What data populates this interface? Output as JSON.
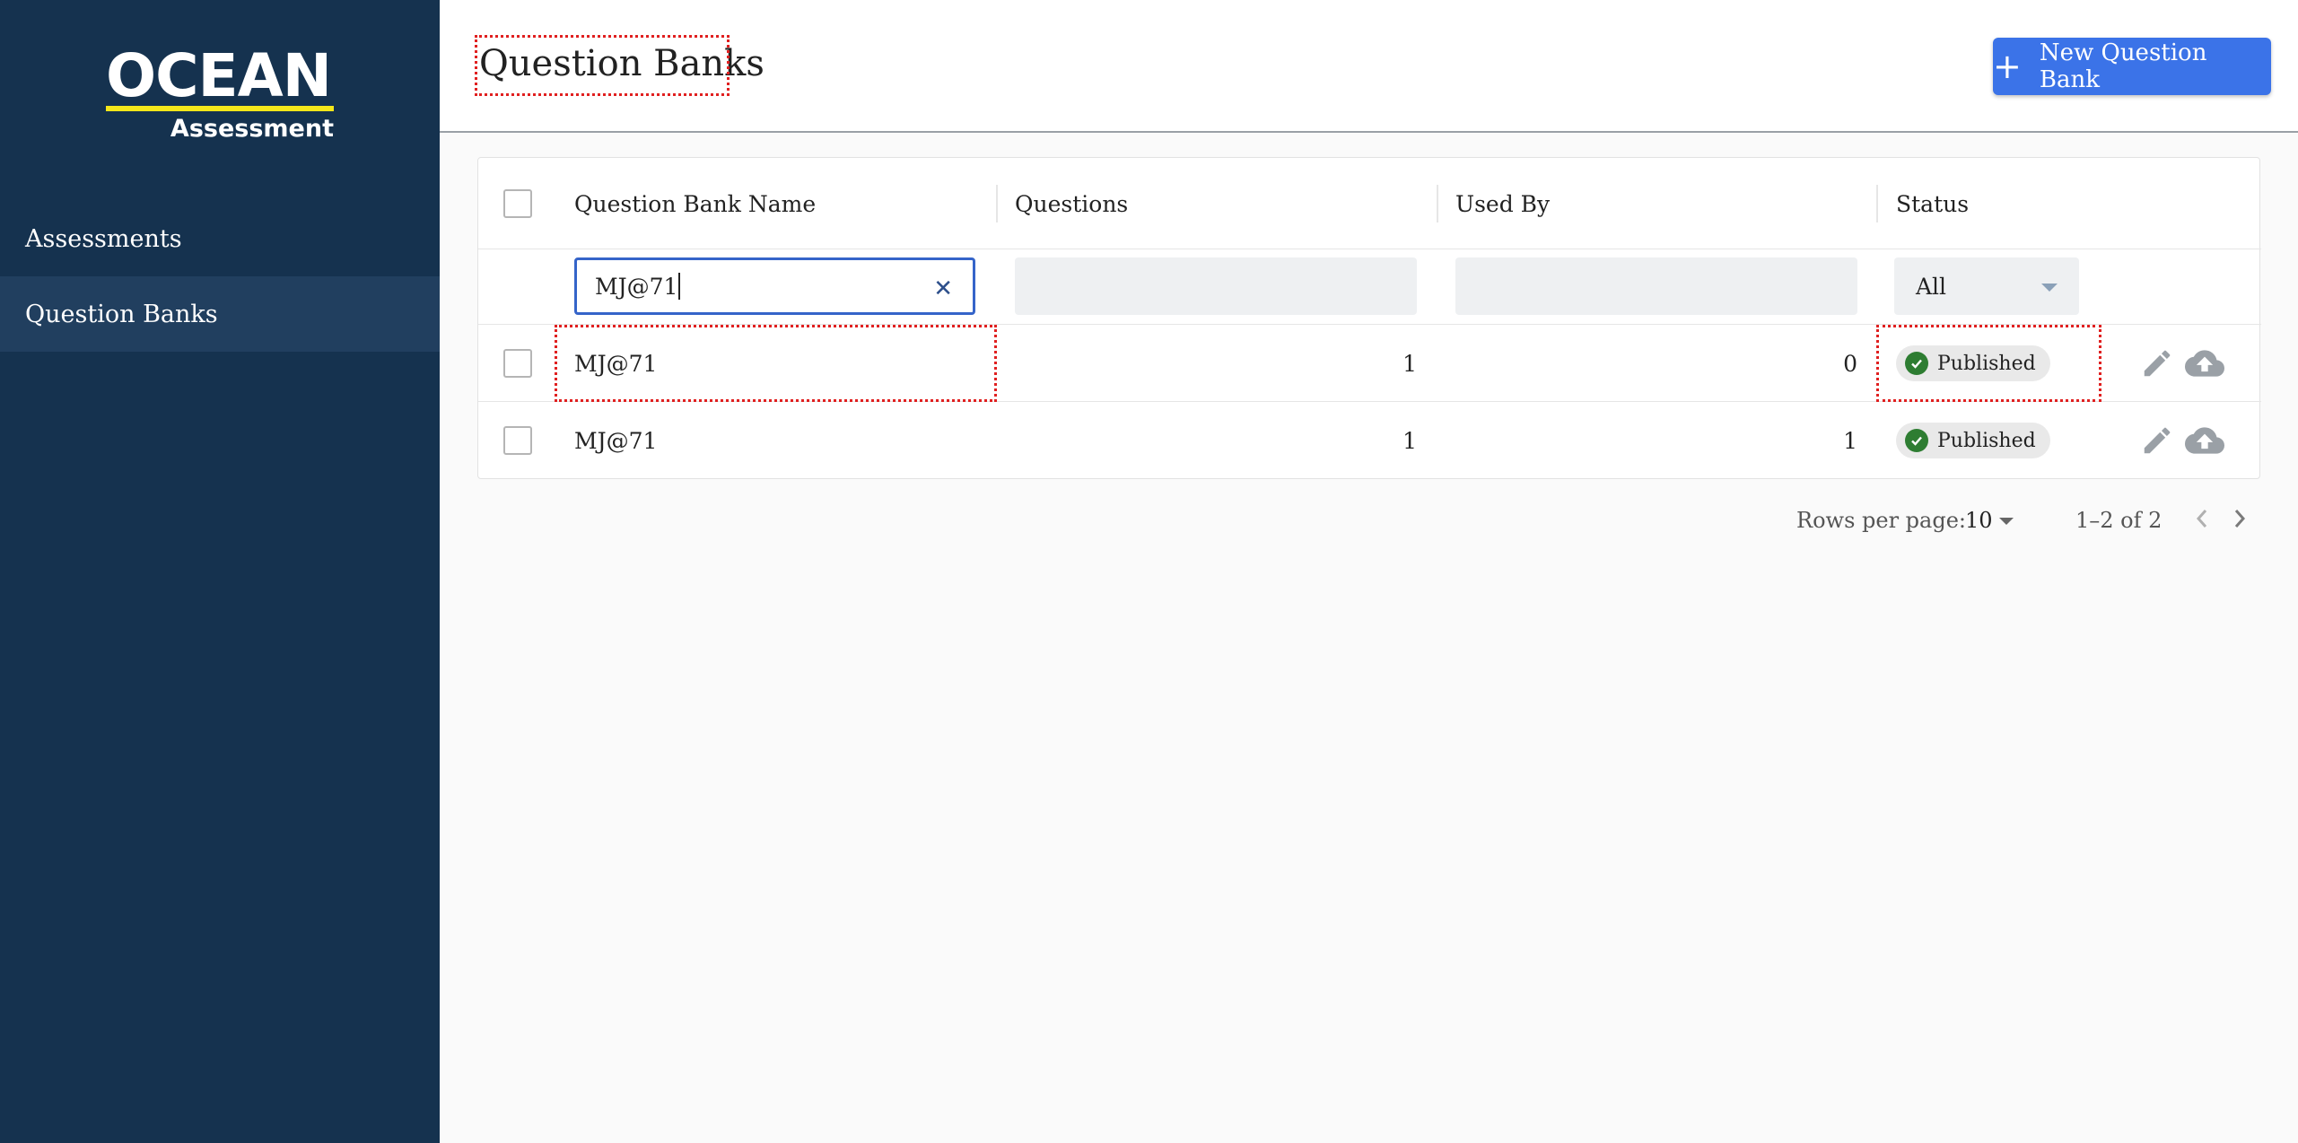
{
  "brand": {
    "name": "OCEAN",
    "subtitle": "Assessment",
    "accent": "#f5e71a"
  },
  "sidebar": {
    "items": [
      {
        "label": "Assessments",
        "active": false
      },
      {
        "label": "Question Banks",
        "active": true
      }
    ]
  },
  "header": {
    "title": "Question Banks",
    "new_button_label": "New Question Bank",
    "new_button_icon": "plus-icon"
  },
  "table": {
    "columns": [
      "Question Bank Name",
      "Questions",
      "Used By",
      "Status"
    ],
    "filters": {
      "name_value": "MJ@71",
      "status_value": "All"
    },
    "rows": [
      {
        "name": "MJ@71",
        "questions": "1",
        "used_by": "0",
        "status": "Published"
      },
      {
        "name": "MJ@71",
        "questions": "1",
        "used_by": "1",
        "status": "Published"
      }
    ]
  },
  "pagination": {
    "rows_per_page_label": "Rows per page:",
    "rows_per_page": "10",
    "range": "1–2 of 2"
  },
  "colors": {
    "sidebar": "#15324f",
    "primary": "#3b73e8",
    "published": "#2e7d32"
  }
}
